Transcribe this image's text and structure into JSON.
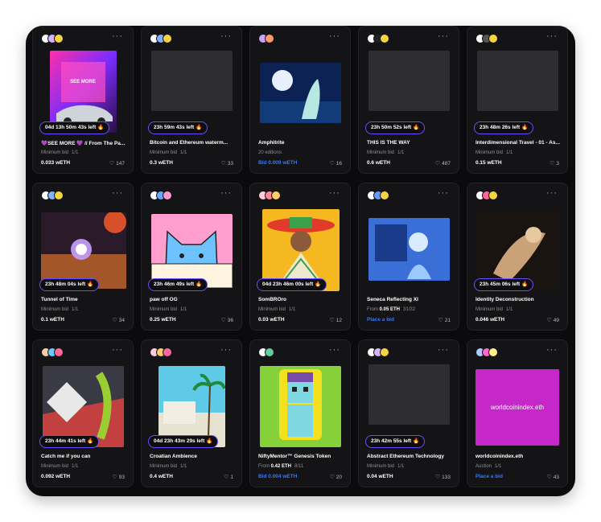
{
  "cards": [
    {
      "title": "💜SEE MORE 💜 // From The Pa...",
      "sub_label": "Minimum bid",
      "edition": "1/1",
      "price": "0.033 wETH",
      "price_blue": false,
      "likes": "147",
      "timer": "04d 13h 50m 43s left 🔥",
      "art": "neon-car",
      "art_text": "SEE MORE"
    },
    {
      "title": "Bitcoin and Ethereum waterm...",
      "sub_label": "Minimum bid",
      "edition": "1/1",
      "price": "0.3 wETH",
      "price_blue": false,
      "likes": "33",
      "timer": "23h 59m 43s left 🔥",
      "art": "placeholder"
    },
    {
      "title": "Amphitrite",
      "sub_label": "20 editions",
      "edition": "",
      "price": "Bid 0.009 wETH",
      "price_blue": true,
      "likes": "16",
      "timer": "",
      "art": "amphitrite"
    },
    {
      "title": "THIS IS THE WAY",
      "sub_label": "Minimum bid",
      "edition": "1/1",
      "price": "0.6 wETH",
      "price_blue": false,
      "likes": "487",
      "timer": "23h 50m 52s left 🔥",
      "art": "placeholder"
    },
    {
      "title": "Interdimensional Travel - 01 - As...",
      "sub_label": "Minimum bid",
      "edition": "1/1",
      "price": "0.15 wETH",
      "price_blue": false,
      "likes": "3",
      "timer": "23h 48m 26s left 🔥",
      "art": "placeholder"
    },
    {
      "title": "Tunnel of Time",
      "sub_label": "Minimum bid",
      "edition": "1/1",
      "price": "0.1 wETH",
      "price_blue": false,
      "likes": "34",
      "timer": "23h 48m 04s left 🔥",
      "art": "tunnel"
    },
    {
      "title": "paw off OG",
      "sub_label": "Minimum bid",
      "edition": "1/1",
      "price": "0.25 wETH",
      "price_blue": false,
      "likes": "36",
      "timer": "23h 46m 49s left 🔥",
      "art": "cat"
    },
    {
      "title": "SomBROro",
      "sub_label": "Minimum bid",
      "edition": "1/1",
      "price": "0.03 wETH",
      "price_blue": false,
      "likes": "12",
      "timer": "04d 23h 46m 00s left 🔥",
      "art": "sombrero"
    },
    {
      "title": "Seneca Reflecting XI",
      "sub_label": "From",
      "sub_strong": "0.05 ETH",
      "edition": "31/32",
      "price": "Place a bid",
      "price_blue": true,
      "likes": "21",
      "timer": "",
      "art": "seneca"
    },
    {
      "title": "Identity Deconstruction",
      "sub_label": "Minimum bid",
      "edition": "1/1",
      "price": "0.046 wETH",
      "price_blue": false,
      "likes": "49",
      "timer": "23h 45m 06s left 🔥",
      "art": "identity"
    },
    {
      "title": "Catch me if you can",
      "sub_label": "Minimum bid",
      "edition": "1/1",
      "price": "0.092 wETH",
      "price_blue": false,
      "likes": "93",
      "timer": "23h 44m 41s left 🔥",
      "art": "catch"
    },
    {
      "title": "Croatian Ambience",
      "sub_label": "Minimum bid",
      "edition": "1/1",
      "price": "0.4 wETH",
      "price_blue": false,
      "likes": "1",
      "timer": "04d 23h 43m 29s left 🔥",
      "art": "croatian"
    },
    {
      "title": "NiftyMentor™ Genesis Token",
      "sub_label": "From",
      "sub_strong": "0.42 ETH",
      "edition": "8/11",
      "price": "Bid 0.004 wETH",
      "price_blue": true,
      "likes": "20",
      "timer": "",
      "art": "nifty"
    },
    {
      "title": "Abstract Ethereum Technology",
      "sub_label": "Minimum bid",
      "edition": "1/1",
      "price": "0.04 wETH",
      "price_blue": false,
      "likes": "133",
      "timer": "23h 42m 55s left 🔥",
      "art": "placeholder"
    },
    {
      "title": "worldcoinindex.eth",
      "sub_label": "Auction",
      "edition": "1/1",
      "price": "Place a bid",
      "price_blue": true,
      "likes": "43",
      "timer": "",
      "art": "worldcoin",
      "art_text": "worldcoinindex.eth"
    }
  ],
  "more_label": "···",
  "heart": "♡"
}
